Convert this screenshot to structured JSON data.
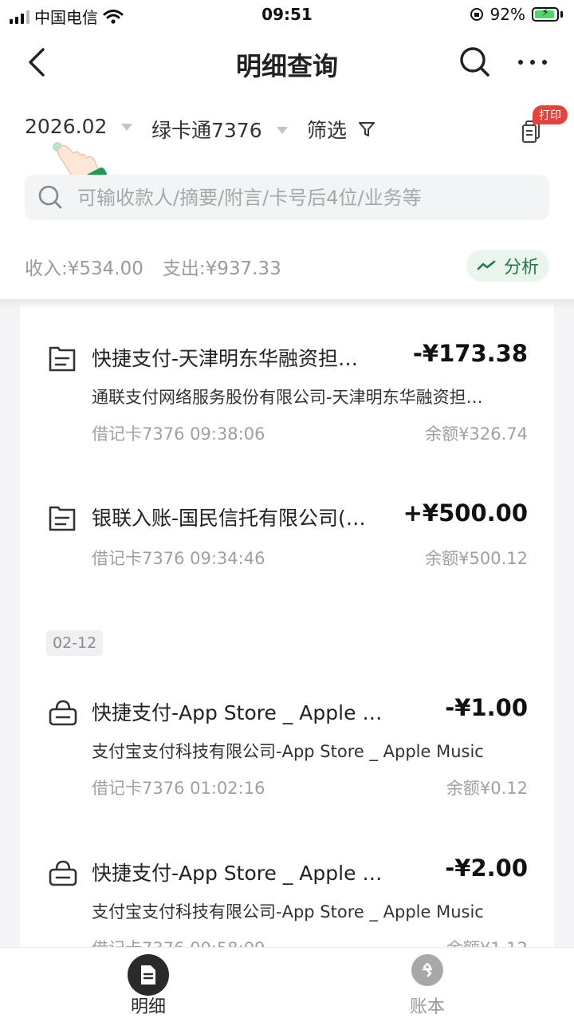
{
  "status_bar": {
    "carrier": "中国电信",
    "time": "09:51",
    "battery_percent": "92%",
    "battery_level": 0.92
  },
  "nav": {
    "title": "明细查询"
  },
  "filters": {
    "month": "2026.02",
    "card": "绿卡通7376",
    "filter_label": "筛选",
    "print_label": "打印"
  },
  "search": {
    "placeholder": "可输收款人/摘要/附言/卡号后4位/业务等"
  },
  "summary": {
    "income": "收入:¥534.00",
    "expense": "支出:¥937.33",
    "analyze_label": "分析"
  },
  "transactions": [
    {
      "icon": "bill-icon",
      "title": "快捷支付-天津明东华融资担…",
      "amount": "-¥173.38",
      "desc": "通联支付网络服务股份有限公司-天津明东华融资担…",
      "meta": "借记卡7376 09:38:06",
      "balance": "余额¥326.74"
    },
    {
      "icon": "bill-icon",
      "title": "银联入账-国民信托有限公司(…",
      "amount": "+¥500.00",
      "desc": "",
      "meta": "借记卡7376 09:34:46",
      "balance": "余额¥500.12"
    },
    {
      "icon": "basket-icon",
      "title": "快捷支付-App Store _ Apple Mu…",
      "amount": "-¥1.00",
      "desc": "支付宝支付科技有限公司-App Store _ Apple Music",
      "meta": "借记卡7376 01:02:16",
      "balance": "余额¥0.12"
    },
    {
      "icon": "basket-icon",
      "title": "快捷支付-App Store _ Apple M…",
      "amount": "-¥2.00",
      "desc": "支付宝支付科技有限公司-App Store _ Apple Music",
      "meta": "借记卡7376 00:58:09",
      "balance": "余额¥1.12"
    }
  ],
  "date_group": "02-12",
  "tabs": [
    {
      "label": "明细",
      "active": true
    },
    {
      "label": "账本",
      "active": false
    }
  ],
  "colors": {
    "accent_green": "#1f7a44",
    "badge_red": "#e8403b",
    "tab_active": "#2a2a2a",
    "tab_inactive": "#9a9a9a"
  }
}
